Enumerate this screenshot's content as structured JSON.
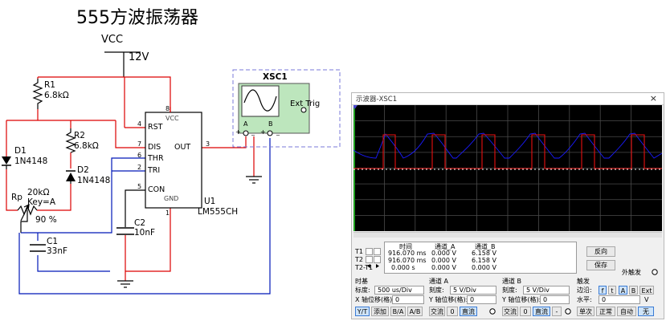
{
  "title": "555方波振荡器",
  "supply": {
    "name": "VCC",
    "value": "12V"
  },
  "components": {
    "r1": {
      "name": "R1",
      "value": "6.8kΩ"
    },
    "r2": {
      "name": "R2",
      "value": "6.8kΩ"
    },
    "d1": {
      "name": "D1",
      "value": "1N4148"
    },
    "d2": {
      "name": "D2",
      "value": "1N4148"
    },
    "rp": {
      "name": "Rp",
      "value": "20kΩ",
      "key": "Key=A",
      "percent": "90 %"
    },
    "c1": {
      "name": "C1",
      "value": "33nF"
    },
    "c2": {
      "name": "C2",
      "value": "10nF"
    },
    "u1": {
      "name": "U1",
      "value": "LM555CH"
    }
  },
  "chip_pins": {
    "rst": "RST",
    "dis": "DIS",
    "thr": "THR",
    "tri": "TRI",
    "con": "CON",
    "vcc": "VCC",
    "out": "OUT",
    "gnd": "GND",
    "num_rst": "4",
    "num_dis": "7",
    "num_thr": "6",
    "num_tri": "2",
    "num_con": "5",
    "num_out": "3",
    "num_vcc": "8",
    "num_gnd": "1"
  },
  "scope_icon": {
    "name": "XSC1",
    "ext": "Ext Trig",
    "a": "A",
    "b": "B",
    "plus": "+",
    "minus": "_"
  },
  "oscilloscope": {
    "window_title": "示波器-XSC1",
    "close": "×",
    "cursor_table": {
      "headers": [
        "时间",
        "通道_A",
        "通道_B"
      ],
      "rows": [
        {
          "label": "T1",
          "time": "916.070 ms",
          "a": "0.000 V",
          "b": "6.158 V"
        },
        {
          "label": "T2",
          "time": "916.070 ms",
          "a": "0.000 V",
          "b": "6.158 V"
        },
        {
          "label": "T2-T1",
          "time": "0.000 s",
          "a": "0.000 V",
          "b": "0.000 V"
        }
      ]
    },
    "reverse_button": "反向",
    "save_button": "保存",
    "ext_trigger": "外触发",
    "timebase": {
      "header": "时基",
      "scale_label": "标度:",
      "scale": "500 us/Div",
      "xpos_label": "X 轴位移(格):",
      "xpos": "0",
      "modes": [
        "Y/T",
        "添加",
        "B/A",
        "A/B"
      ]
    },
    "channel_a": {
      "header": "通道 A",
      "scale_label": "刻度:",
      "scale": "5  V/Div",
      "ypos_label": "Y 轴位移(格):",
      "ypos": "0",
      "coupling": [
        "交流",
        "0",
        "直流"
      ]
    },
    "channel_b": {
      "header": "通道 B",
      "scale_label": "刻度:",
      "scale": "5  V/Div",
      "ypos_label": "Y 轴位移(格):",
      "ypos": "0",
      "coupling": [
        "交流",
        "0",
        "直流",
        "-"
      ]
    },
    "trigger": {
      "header": "触发",
      "edge_label": "边沿:",
      "edge_options": [
        "f",
        "t",
        "A",
        "B",
        "Ext"
      ],
      "level_label": "水平:",
      "level": "0",
      "level_unit": "V",
      "modes": [
        "单次",
        "正常",
        "自动",
        "无"
      ]
    },
    "colors": {
      "channel_a": "#1a1aff",
      "channel_b": "#e81010",
      "screen": "#000000",
      "grid": "#4a4a4a"
    }
  }
}
